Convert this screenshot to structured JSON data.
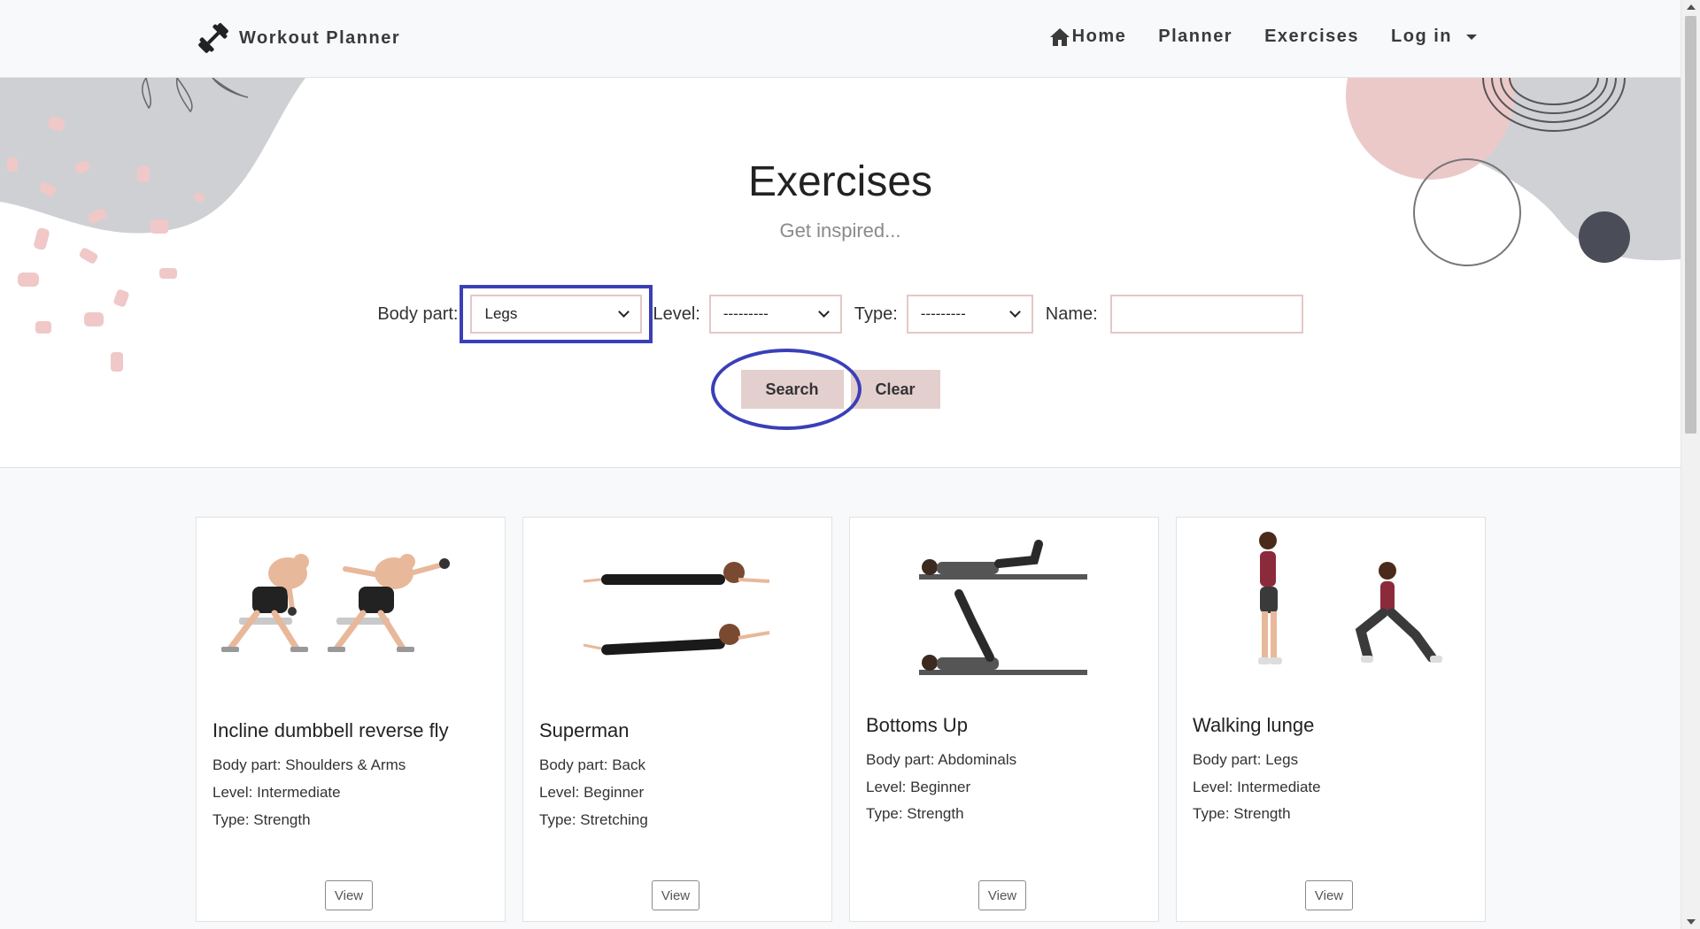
{
  "navbar": {
    "brand": "Workout Planner",
    "brand_icon": "dumbbell-icon",
    "links": [
      {
        "label": "Home",
        "icon": "home-icon"
      },
      {
        "label": "Planner"
      },
      {
        "label": "Exercises"
      },
      {
        "label": "Log in",
        "icon": "caret-down-icon"
      }
    ]
  },
  "hero": {
    "title": "Exercises",
    "subtitle": "Get inspired..."
  },
  "filters": {
    "body_part_label": "Body part:",
    "body_part_value": "Legs",
    "level_label": "Level:",
    "level_value": "---------",
    "type_label": "Type:",
    "type_value": "---------",
    "name_label": "Name:",
    "name_value": ""
  },
  "buttons": {
    "search": "Search",
    "clear": "Clear"
  },
  "cards": [
    {
      "title": "Incline dumbbell reverse fly",
      "body_part": "Body part: Shoulders & Arms",
      "level": "Level: Intermediate",
      "type": "Type: Strength",
      "view": "View"
    },
    {
      "title": "Superman",
      "body_part": "Body part: Back",
      "level": "Level: Beginner",
      "type": "Type: Stretching",
      "view": "View"
    },
    {
      "title": "Bottoms Up",
      "body_part": "Body part: Abdominals",
      "level": "Level: Beginner",
      "type": "Type: Strength",
      "view": "View"
    },
    {
      "title": "Walking lunge",
      "body_part": "Body part: Legs",
      "level": "Level: Intermediate",
      "type": "Type: Strength",
      "view": "View"
    }
  ],
  "colors": {
    "accent_button": "#e4cfcf",
    "annotation": "#3a3fb8"
  }
}
